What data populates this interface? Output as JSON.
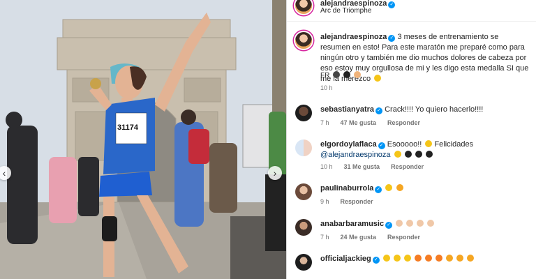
{
  "header": {
    "username": "alejandraespinoza",
    "location": "Arc de Triomphe"
  },
  "caption": {
    "username": "alejandraespinoza",
    "text": "3 meses de entrenamiento se resumen en esto! Para este maratón me preparé como para ningún otro y también me dio muchos dolores de cabeza por eso estoy muy orgullosa de mi y les digo esta medalla SI que me la merezco",
    "flag": "FR",
    "time": "10 h"
  },
  "photo": {
    "bib_number": "31174"
  },
  "comments": [
    {
      "username": "sebastianyatra",
      "text": "Crack!!!! Yo quiero hacerlo!!!!",
      "time": "7 h",
      "likes": "47 Me gusta",
      "reply": "Responder"
    },
    {
      "username": "elgordoylaflaca",
      "text": "Esooooo!!",
      "text2": "Felicidades",
      "mention": "@alejandraespinoza",
      "time": "10 h",
      "likes": "31 Me gusta",
      "reply": "Responder"
    },
    {
      "username": "paulinaburrola",
      "text": "",
      "time": "9 h",
      "reply": "Responder"
    },
    {
      "username": "anabarbaramusic",
      "text": "",
      "time": "7 h",
      "likes": "24 Me gusta",
      "reply": "Responder"
    },
    {
      "username": "officialjackieg",
      "text": ""
    }
  ],
  "icons": {
    "prev": "chevron-left-icon",
    "next": "chevron-right-icon",
    "verified": "verified-badge-icon"
  }
}
